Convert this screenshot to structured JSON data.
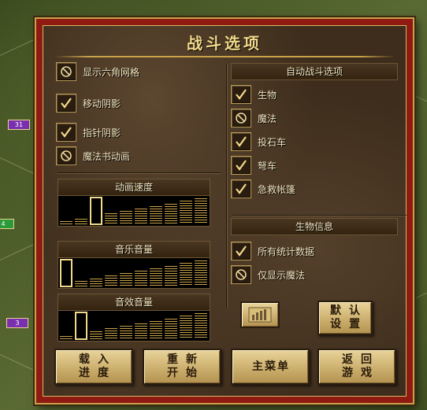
{
  "dialog": {
    "title": "战斗选项"
  },
  "left_options": [
    {
      "label": "显示六角网格",
      "checked": false
    },
    {
      "label": "移动阴影",
      "checked": true
    },
    {
      "label": "指针阴影",
      "checked": true
    },
    {
      "label": "魔法书动画",
      "checked": false
    }
  ],
  "auto_combat": {
    "header": "自动战斗选项",
    "options": [
      {
        "label": "生物",
        "checked": true
      },
      {
        "label": "魔法",
        "checked": false
      },
      {
        "label": "投石车",
        "checked": true
      },
      {
        "label": "弩车",
        "checked": true
      },
      {
        "label": "急救帐篷",
        "checked": true
      }
    ]
  },
  "creature_info": {
    "header": "生物信息",
    "options": [
      {
        "label": "所有统计数据",
        "checked": true
      },
      {
        "label": "仅显示魔法",
        "checked": false
      }
    ]
  },
  "sliders": {
    "animation_speed": {
      "label": "动画速度",
      "level": 2,
      "steps": 10
    },
    "music_volume": {
      "label": "音乐音量",
      "level": 0,
      "steps": 10
    },
    "sound_volume": {
      "label": "音效音量",
      "level": 1,
      "steps": 10
    }
  },
  "buttons": {
    "defaults": {
      "line1": "默认",
      "line2": "设置"
    },
    "load": {
      "line1": "载入",
      "line2": "进度"
    },
    "restart": {
      "line1": "重新",
      "line2": "开始"
    },
    "main_menu": {
      "label": "主菜单"
    },
    "return": {
      "line1": "返回",
      "line2": "游戏"
    }
  },
  "battlefield": {
    "unit_counts": [
      "31",
      "4",
      "3"
    ]
  },
  "colors": {
    "frame_red": "#8e1a12",
    "gold": "#c9a24a",
    "text": "#f2e6c0"
  }
}
